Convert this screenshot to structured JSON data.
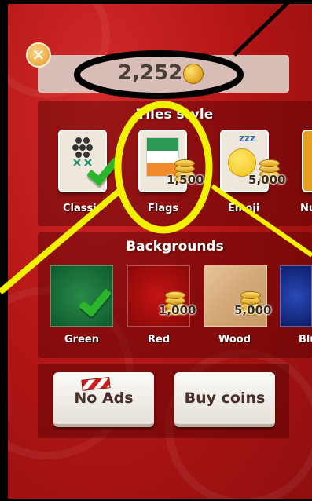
{
  "coins": {
    "balance": "2,252"
  },
  "close_label": "✕",
  "tiles_section": {
    "title": "Tiles style",
    "items": [
      {
        "label": "Classic",
        "price": "",
        "owned": true
      },
      {
        "label": "Flags",
        "price": "1,500",
        "owned": false
      },
      {
        "label": "Emoji",
        "price": "5,000",
        "owned": false
      },
      {
        "label": "Nu",
        "price": "",
        "owned": false
      }
    ]
  },
  "backgrounds_section": {
    "title": "Backgrounds",
    "items": [
      {
        "label": "Green",
        "price": "",
        "owned": true
      },
      {
        "label": "Red",
        "price": "1,000",
        "owned": false
      },
      {
        "label": "Wood",
        "price": "5,000",
        "owned": false
      },
      {
        "label": "Blu",
        "price": "",
        "owned": false
      }
    ]
  },
  "actions": {
    "no_ads": "No Ads",
    "buy_coins": "Buy coins"
  },
  "emoji_text": "zzz",
  "colors": {
    "panel_red": "#b51616",
    "highlight_yellow": "#f2f200",
    "check_green": "#2bb52b",
    "coin_gold": "#e0a419"
  }
}
